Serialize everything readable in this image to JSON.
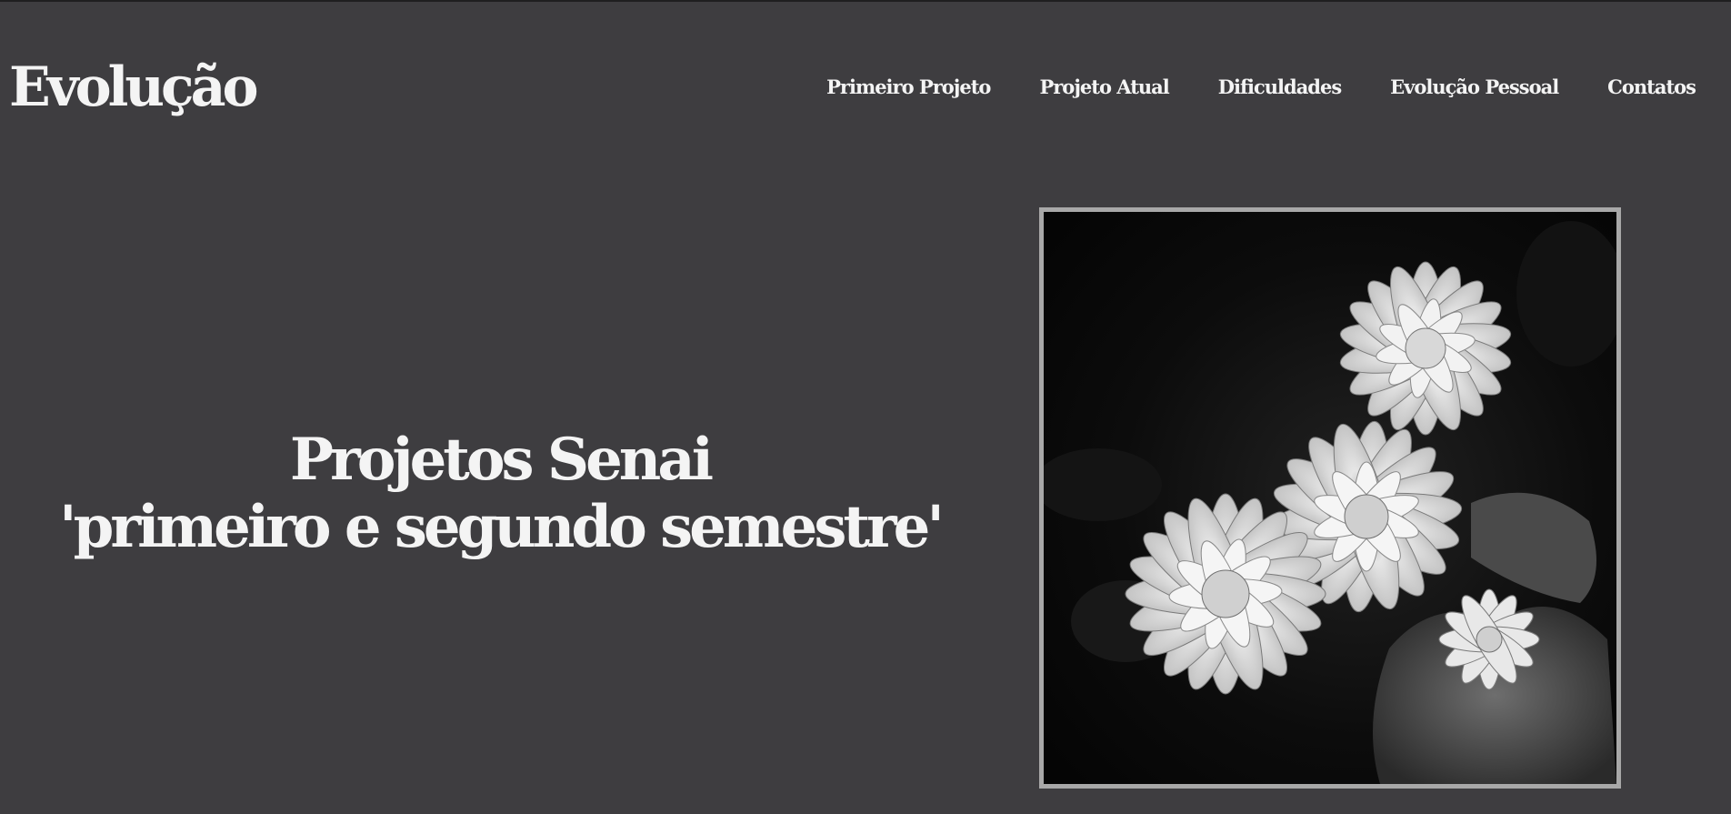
{
  "header": {
    "logo": "Evolução",
    "nav": [
      {
        "label": "Primeiro Projeto"
      },
      {
        "label": "Projeto Atual"
      },
      {
        "label": "Dificuldades"
      },
      {
        "label": "Evolução Pessoal"
      },
      {
        "label": "Contatos"
      }
    ]
  },
  "hero": {
    "title_line1": "Projetos Senai",
    "title_line2": "'primeiro e segundo semestre'"
  },
  "image": {
    "subject": "black-and-white chrysanthemum flowers",
    "frame_color": "#a8a8a8"
  },
  "colors": {
    "background": "#3e3d40",
    "text": "#f4f4f4"
  }
}
